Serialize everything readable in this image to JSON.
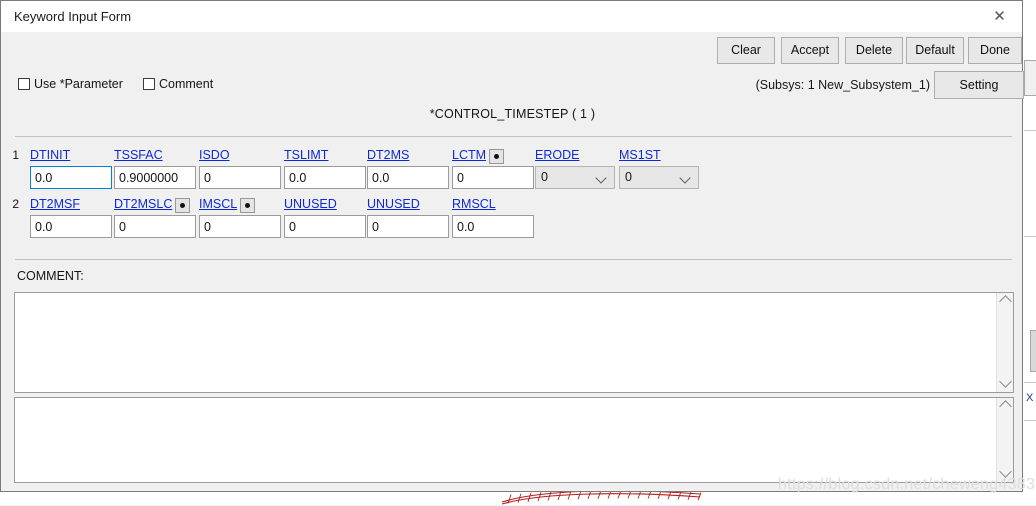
{
  "window": {
    "title": "Keyword Input Form",
    "close_icon": "close-icon"
  },
  "toolbar": {
    "clear_label": "Clear",
    "accept_label": "Accept",
    "delete_label": "Delete",
    "default_label": "Default",
    "done_label": "Done",
    "setting_label": "Setting",
    "subsys_label": "(Subsys: 1 New_Subsystem_1)"
  },
  "options": {
    "use_parameter_label": "Use *Parameter",
    "use_parameter_checked": false,
    "comment_label": "Comment",
    "comment_checked": false
  },
  "keyword": {
    "title": "*CONTROL_TIMESTEP    ( 1 )"
  },
  "fields": {
    "row1_number": "1",
    "row2_number": "2",
    "row1": [
      {
        "label": "DTINIT",
        "value": "0.0",
        "type": "text",
        "dot": false,
        "focused": true
      },
      {
        "label": "TSSFAC",
        "value": "0.9000000",
        "type": "text",
        "dot": false,
        "focused": false
      },
      {
        "label": "ISDO",
        "value": "0",
        "type": "text",
        "dot": false,
        "focused": false
      },
      {
        "label": "TSLIMT",
        "value": "0.0",
        "type": "text",
        "dot": false,
        "focused": false
      },
      {
        "label": "DT2MS",
        "value": "0.0",
        "type": "text",
        "dot": false,
        "focused": false
      },
      {
        "label": "LCTM",
        "value": "0",
        "type": "text",
        "dot": true,
        "focused": false
      },
      {
        "label": "ERODE",
        "value": "0",
        "type": "select",
        "dot": false,
        "focused": false
      },
      {
        "label": "MS1ST",
        "value": "0",
        "type": "select",
        "dot": false,
        "focused": false
      }
    ],
    "row2": [
      {
        "label": "DT2MSF",
        "value": "0.0",
        "type": "text",
        "dot": false,
        "focused": false
      },
      {
        "label": "DT2MSLC",
        "value": "0",
        "type": "text",
        "dot": true,
        "focused": false
      },
      {
        "label": "IMSCL",
        "value": "0",
        "type": "text",
        "dot": true,
        "focused": false
      },
      {
        "label": "UNUSED",
        "value": "0",
        "type": "text",
        "dot": false,
        "focused": false
      },
      {
        "label": "UNUSED",
        "value": "0",
        "type": "text",
        "dot": false,
        "focused": false
      },
      {
        "label": "RMSCL",
        "value": "0.0",
        "type": "text",
        "dot": false,
        "focused": false
      }
    ]
  },
  "comment": {
    "label": "COMMENT:",
    "text_1": "",
    "text_2": ""
  },
  "watermark": {
    "text": "https://blog.csdn.net/cheweng4383"
  },
  "colors": {
    "field_link": "#0d2ad2",
    "focus_border": "#0a7fd4",
    "dialog_bg": "#f0f0f0",
    "button_bg": "#e8e8e8"
  }
}
